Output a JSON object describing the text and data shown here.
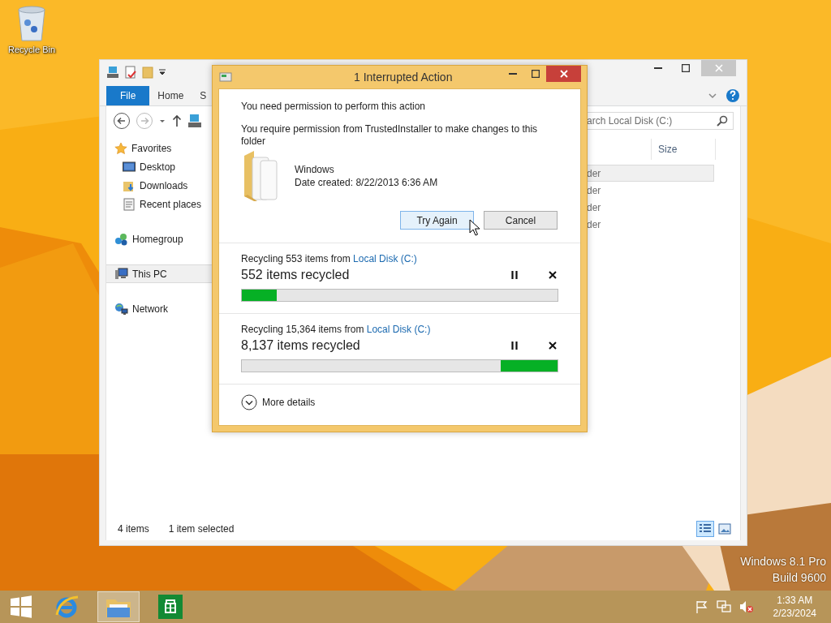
{
  "desktop": {
    "icons": [
      {
        "label": "Recycle Bin"
      }
    ],
    "edition": [
      "Windows 8.1 Pro",
      "Build 9600"
    ]
  },
  "explorer": {
    "ribbon_tabs": [
      {
        "label": "File",
        "kind": "backstage"
      },
      {
        "label": "Home",
        "kind": "tab"
      },
      {
        "label": "S",
        "kind": "tab"
      }
    ],
    "search": {
      "placeholder": "arch Local Disk (C:)"
    },
    "nav": [
      {
        "label": "Favorites",
        "kind": "favorites",
        "selected": false,
        "children": [
          {
            "label": "Desktop",
            "kind": "desktop",
            "selected": false
          },
          {
            "label": "Downloads",
            "kind": "downloads",
            "selected": false
          },
          {
            "label": "Recent places",
            "kind": "recent",
            "selected": false
          }
        ]
      },
      {
        "label": "Homegroup",
        "kind": "homegroup",
        "selected": false
      },
      {
        "label": "This PC",
        "kind": "pc",
        "selected": true
      },
      {
        "label": "Network",
        "kind": "network",
        "selected": false
      }
    ],
    "columns": [
      {
        "label": "Size"
      }
    ],
    "rows": [
      {
        "type": "der",
        "selected": true
      },
      {
        "type": "der",
        "selected": false
      },
      {
        "type": "der",
        "selected": false
      },
      {
        "type": "der",
        "selected": false
      }
    ],
    "status": {
      "count": "4 items",
      "selection": "1 item selected"
    },
    "view_buttons": [
      {
        "kind": "details",
        "selected": true
      },
      {
        "kind": "tiles",
        "selected": false
      }
    ]
  },
  "dialog": {
    "title": "1 Interrupted Action",
    "heading": "You need permission to perform this action",
    "message": "You require permission from TrustedInstaller to make changes to this folder",
    "item": {
      "name": "Windows",
      "date": "Date created: 8/22/2013 6:36 AM"
    },
    "buttons": [
      {
        "label": "Try Again",
        "hovered": true
      },
      {
        "label": "Cancel",
        "hovered": false
      }
    ],
    "operations": [
      {
        "source": "Recycling 553 items from",
        "link": "Local Disk (C:)",
        "status": "552 items recycled",
        "level": 0.11,
        "reversed": false
      },
      {
        "source": "Recycling 15,364 items from",
        "link": "Local Disk (C:)",
        "status": "8,137 items recycled",
        "level": 0.18,
        "reversed": true
      }
    ],
    "more_details": "More details"
  },
  "taskbar": {
    "apps": [
      {
        "kind": "browser",
        "active": false
      },
      {
        "kind": "explorer",
        "active": true
      },
      {
        "kind": "store",
        "active": false
      }
    ],
    "tray": {
      "volume_muted": true
    },
    "clock": {
      "time": "1:33 AM",
      "date": "2/23/2024"
    }
  }
}
